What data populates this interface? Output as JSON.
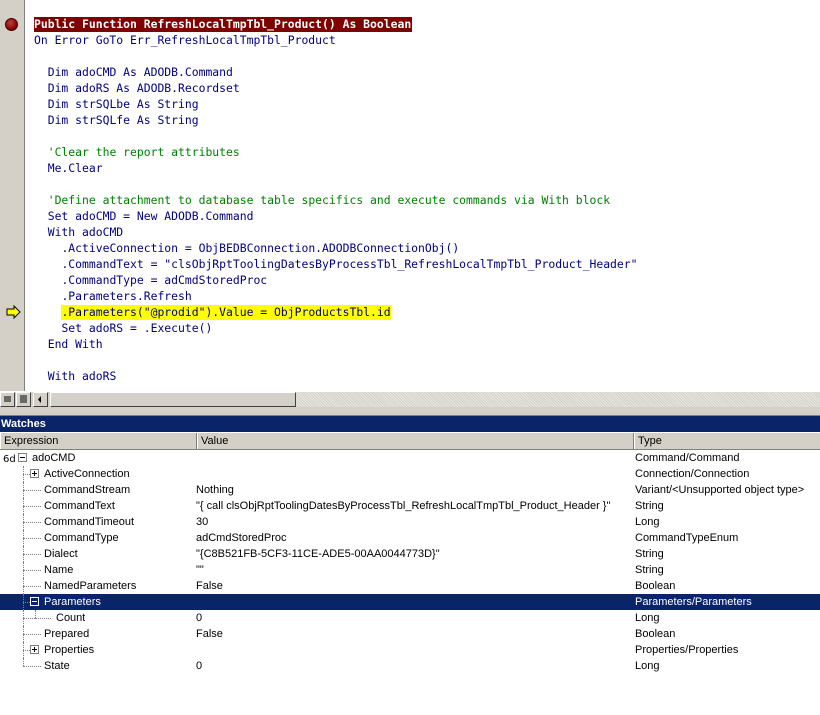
{
  "code": {
    "lines": [
      {
        "indent": "",
        "segments": [
          {
            "t": "Public Function RefreshLocalTmpTbl_Product() As Boolean",
            "c": "sig"
          }
        ]
      },
      {
        "indent": "",
        "segments": [
          {
            "t": "On Error GoTo Err_RefreshLocalTmpTbl_Product",
            "c": "kw"
          }
        ]
      },
      {
        "indent": "",
        "segments": []
      },
      {
        "indent": "  ",
        "segments": [
          {
            "t": "Dim adoCMD As ADODB.Command",
            "c": "kw"
          }
        ]
      },
      {
        "indent": "  ",
        "segments": [
          {
            "t": "Dim adoRS As ADODB.Recordset",
            "c": "kw"
          }
        ]
      },
      {
        "indent": "  ",
        "segments": [
          {
            "t": "Dim strSQLbe As String",
            "c": "kw"
          }
        ]
      },
      {
        "indent": "  ",
        "segments": [
          {
            "t": "Dim strSQLfe As String",
            "c": "kw"
          }
        ]
      },
      {
        "indent": "",
        "segments": []
      },
      {
        "indent": "  ",
        "segments": [
          {
            "t": "'Clear the report attributes",
            "c": "cm"
          }
        ]
      },
      {
        "indent": "  ",
        "segments": [
          {
            "t": "Me.Clear",
            "c": "kw"
          }
        ]
      },
      {
        "indent": "",
        "segments": []
      },
      {
        "indent": "  ",
        "segments": [
          {
            "t": "'Define attachment to database table specifics and execute commands via With block",
            "c": "cm"
          }
        ]
      },
      {
        "indent": "  ",
        "segments": [
          {
            "t": "Set adoCMD = New ADODB.Command",
            "c": "kw"
          }
        ]
      },
      {
        "indent": "  ",
        "segments": [
          {
            "t": "With adoCMD",
            "c": "kw"
          }
        ]
      },
      {
        "indent": "    ",
        "segments": [
          {
            "t": ".ActiveConnection = ObjBEDBConnection.ADODBConnectionObj()",
            "c": "kw"
          }
        ]
      },
      {
        "indent": "    ",
        "segments": [
          {
            "t": ".CommandText = \"clsObjRptToolingDatesByProcessTbl_RefreshLocalTmpTbl_Product_Header\"",
            "c": "kw"
          }
        ]
      },
      {
        "indent": "    ",
        "segments": [
          {
            "t": ".CommandType = adCmdStoredProc",
            "c": "kw"
          }
        ]
      },
      {
        "indent": "    ",
        "segments": [
          {
            "t": ".Parameters.Refresh",
            "c": "kw"
          }
        ]
      },
      {
        "indent": "    ",
        "segments": [
          {
            "t": ".Parameters(\"@prodid\").Value = ObjProductsTbl.id",
            "c": "cur"
          }
        ]
      },
      {
        "indent": "    ",
        "segments": [
          {
            "t": "Set adoRS = .Execute()",
            "c": "kw"
          }
        ]
      },
      {
        "indent": "  ",
        "segments": [
          {
            "t": "End With",
            "c": "kw"
          }
        ]
      },
      {
        "indent": "",
        "segments": []
      },
      {
        "indent": "  ",
        "segments": [
          {
            "t": "With adoRS",
            "c": "kw"
          }
        ]
      }
    ],
    "breakpoint_line": 0,
    "current_line": 18
  },
  "watches": {
    "title": "Watches",
    "columns": {
      "expression": "Expression",
      "value": "Value",
      "type": "Type"
    },
    "rows": [
      {
        "glyph": "6d",
        "expr": "adoCMD",
        "value": "",
        "type": "Command/Command",
        "level": 0,
        "toggle": "minus"
      },
      {
        "expr": "ActiveConnection",
        "value": "",
        "type": "Connection/Connection",
        "level": 1,
        "toggle": "plus"
      },
      {
        "expr": "CommandStream",
        "value": "Nothing",
        "type": "Variant/<Unsupported object type>",
        "level": 1
      },
      {
        "expr": "CommandText",
        "value": "\"{ call clsObjRptToolingDatesByProcessTbl_RefreshLocalTmpTbl_Product_Header }\"",
        "type": "String",
        "level": 1
      },
      {
        "expr": "CommandTimeout",
        "value": "30",
        "type": "Long",
        "level": 1
      },
      {
        "expr": "CommandType",
        "value": "adCmdStoredProc",
        "type": "CommandTypeEnum",
        "level": 1
      },
      {
        "expr": "Dialect",
        "value": "\"{C8B521FB-5CF3-11CE-ADE5-00AA0044773D}\"",
        "type": "String",
        "level": 1
      },
      {
        "expr": "Name",
        "value": "\"\"",
        "type": "String",
        "level": 1
      },
      {
        "expr": "NamedParameters",
        "value": "False",
        "type": "Boolean",
        "level": 1
      },
      {
        "expr": "Parameters",
        "value": "",
        "type": "Parameters/Parameters",
        "level": 1,
        "toggle": "minus",
        "selected": true
      },
      {
        "expr": "Count",
        "value": "0",
        "type": "Long",
        "level": 2
      },
      {
        "expr": "Prepared",
        "value": "False",
        "type": "Boolean",
        "level": 1
      },
      {
        "expr": "Properties",
        "value": "",
        "type": "Properties/Properties",
        "level": 1,
        "toggle": "plus"
      },
      {
        "expr": "State",
        "value": "0",
        "type": "Long",
        "level": 1
      }
    ]
  }
}
